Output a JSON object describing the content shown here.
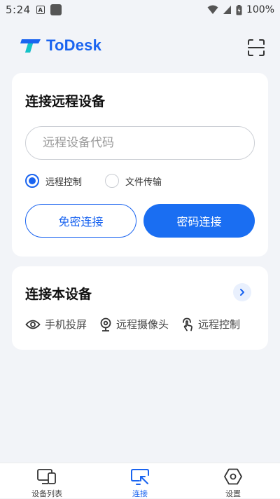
{
  "status_bar": {
    "time": "5:24",
    "battery": "100%"
  },
  "header": {
    "logo_text": "ToDesk",
    "scan_icon": "scan-icon"
  },
  "remote_card": {
    "title": "连接远程设备",
    "input": {
      "placeholder": "远程设备代码",
      "value": ""
    },
    "options": [
      {
        "label": "远程控制",
        "selected": true
      },
      {
        "label": "文件传输",
        "selected": false
      }
    ],
    "buttons": {
      "passwordless": "免密连接",
      "password": "密码连接"
    }
  },
  "local_card": {
    "title": "连接本设备",
    "features": [
      {
        "label": "手机投屏",
        "icon": "eye-icon"
      },
      {
        "label": "远程摄像头",
        "icon": "webcam-icon"
      },
      {
        "label": "远程控制",
        "icon": "touch-icon"
      }
    ]
  },
  "bottom_nav": {
    "items": [
      {
        "label": "设备列表",
        "icon": "devices-icon",
        "active": false
      },
      {
        "label": "连接",
        "icon": "connect-icon",
        "active": true
      },
      {
        "label": "设置",
        "icon": "settings-icon",
        "active": false
      }
    ]
  },
  "colors": {
    "accent": "#1a64f0",
    "background": "#f2f4f8",
    "card": "#ffffff"
  }
}
